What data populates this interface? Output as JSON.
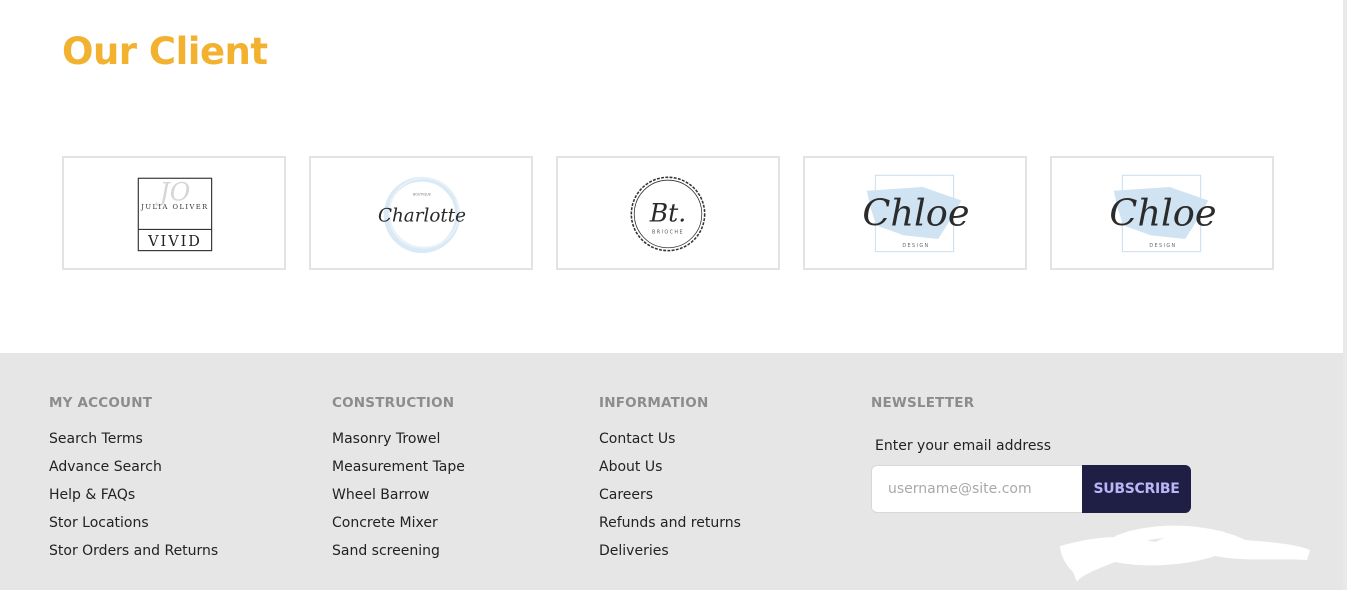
{
  "clients": {
    "title": "Our Client",
    "logos": [
      {
        "name": "Julia Oliver Vivid",
        "top_text": "JULIA OLIVER",
        "monogram": "JO",
        "bottom_text": "VIVID"
      },
      {
        "name": "Charlotte",
        "script_text": "Charlotte",
        "small_text": "BOUTIQUE"
      },
      {
        "name": "Brioche",
        "monogram": "Bt.",
        "small_text": "BRIOCHE"
      },
      {
        "name": "Chloe Design",
        "script_text": "Chloe",
        "small_text": "DESIGN"
      },
      {
        "name": "Chloe Design",
        "script_text": "Chloe",
        "small_text": "DESIGN"
      }
    ]
  },
  "footer": {
    "columns": [
      {
        "title": "MY ACCOUNT",
        "links": [
          "Search Terms",
          "Advance Search",
          "Help & FAQs",
          "Stor Locations",
          "Stor Orders and Returns"
        ]
      },
      {
        "title": "CONSTRUCTION",
        "links": [
          "Masonry Trowel",
          "Measurement Tape",
          "Wheel Barrow",
          "Concrete Mixer",
          "Sand screening"
        ]
      },
      {
        "title": "INFORMATION",
        "links": [
          "Contact Us",
          "About Us",
          "Careers",
          "Refunds and returns",
          "Deliveries"
        ]
      }
    ],
    "newsletter": {
      "title": "NEWSLETTER",
      "label": "Enter your email address",
      "placeholder": "username@site.com",
      "button": "SUBSCRIBE"
    }
  },
  "colors": {
    "title_accent": "#f2b230",
    "footer_bg": "#e6e6e6",
    "button_bg": "#1f1e45",
    "button_text": "#b9b6f6",
    "logo_wash": "#cfe3f3"
  }
}
